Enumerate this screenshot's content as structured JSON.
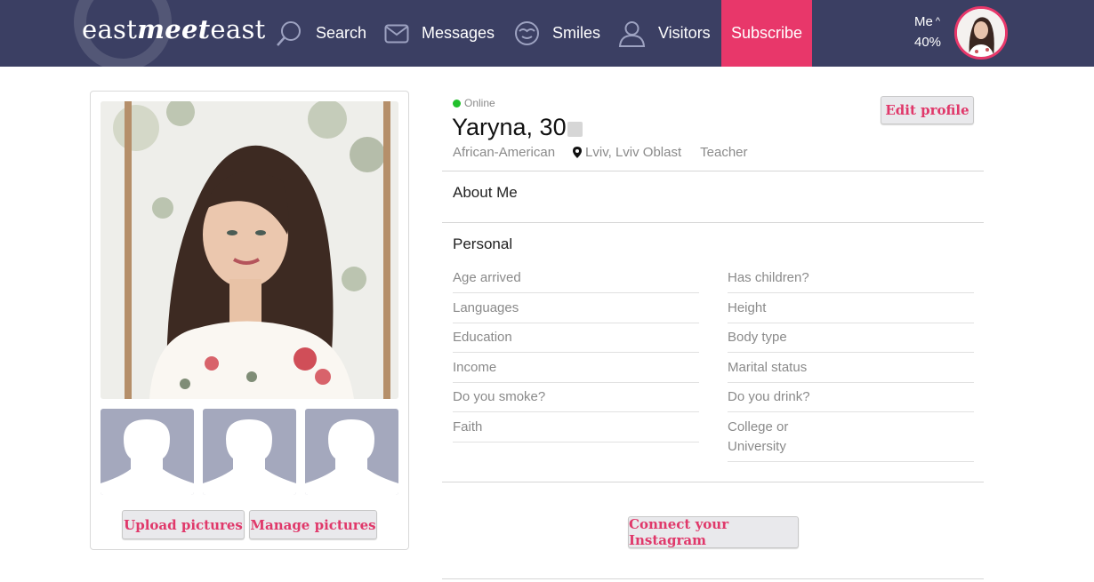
{
  "header": {
    "logo": {
      "part1": "east",
      "part2": "meet",
      "part3": "east"
    },
    "nav": [
      {
        "label": "Search",
        "icon": "search-icon"
      },
      {
        "label": "Messages",
        "icon": "envelope-icon"
      },
      {
        "label": "Smiles",
        "icon": "smile-icon"
      },
      {
        "label": "Visitors",
        "icon": "user-icon"
      }
    ],
    "subscribe": "Subscribe",
    "me": {
      "label": "Me",
      "caret": "^",
      "completion": "40%"
    }
  },
  "left": {
    "upload": "Upload pictures",
    "manage": "Manage pictures"
  },
  "profile": {
    "status": "Online",
    "name": "Yaryna, 30",
    "ethnicity": "African-American",
    "location": "Lviv, Lviv Oblast",
    "occupation": "Teacher",
    "edit": "Edit profile"
  },
  "sections": {
    "about": "About Me",
    "personal": "Personal"
  },
  "personal_left": [
    "Age arrived",
    "Languages",
    "Education",
    "Income",
    "Do you smoke?",
    "Faith"
  ],
  "personal_right": [
    "Has children?",
    "Height",
    "Body type",
    "Marital status",
    "Do you drink?",
    "College or University"
  ],
  "instagram": "Connect your Instagram",
  "colors": {
    "header": "#3b3f63",
    "accent": "#e8376a",
    "online": "#22c02c"
  }
}
